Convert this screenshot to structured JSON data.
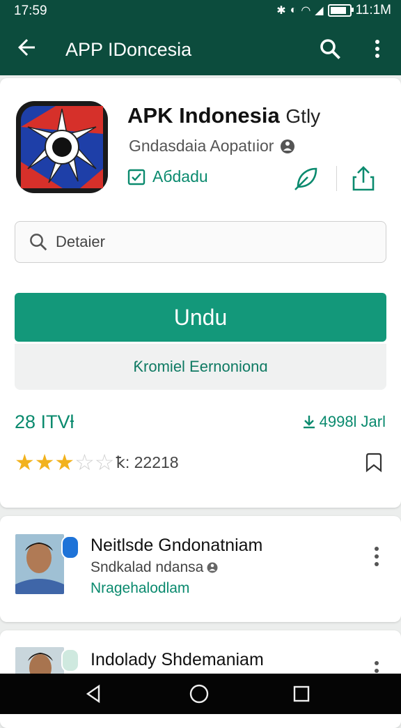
{
  "status_bar": {
    "time": "17:59",
    "clock_right": "11:1M",
    "icons": [
      "bluetooth-icon",
      "alarm-icon",
      "wifi-icon",
      "signal-icon",
      "battery-icon"
    ]
  },
  "app_bar": {
    "title": "APP IDoncesia",
    "icons": [
      "back-arrow-icon",
      "search-icon",
      "more-vert-icon"
    ]
  },
  "app": {
    "name": "APK Indonesia",
    "name_suffix": "Gtly",
    "developer": "Gndasdaia Aopatıior",
    "install_state": "Aбdаdu",
    "icons": [
      "app-logo-icon",
      "info-icon",
      "checkbox-icon",
      "leaf-icon",
      "share-icon"
    ]
  },
  "search": {
    "placeholder": "Detaier"
  },
  "actions": {
    "install_label": "Undu",
    "secondary_label": "Ƙromiel Eernonionɑ"
  },
  "stats": {
    "left_text": "28 ITVƚ",
    "downloads_text": "4998l Jarl",
    "rating_value": 3,
    "rating_max": 5,
    "rating_count": "ꝁ: 22218"
  },
  "reviews": [
    {
      "name": "Neitlsde Gndonatniam",
      "subtitle": "Sndkalad ndansa",
      "link": "Nragehalodlam"
    },
    {
      "name": "Indolady Shdemaniam",
      "subtitle": "",
      "link": ""
    }
  ],
  "colors": {
    "primary_dark": "#0c4c3d",
    "accent": "#13987a",
    "accent_text": "#0a8a6e",
    "star": "#f2b21d"
  }
}
